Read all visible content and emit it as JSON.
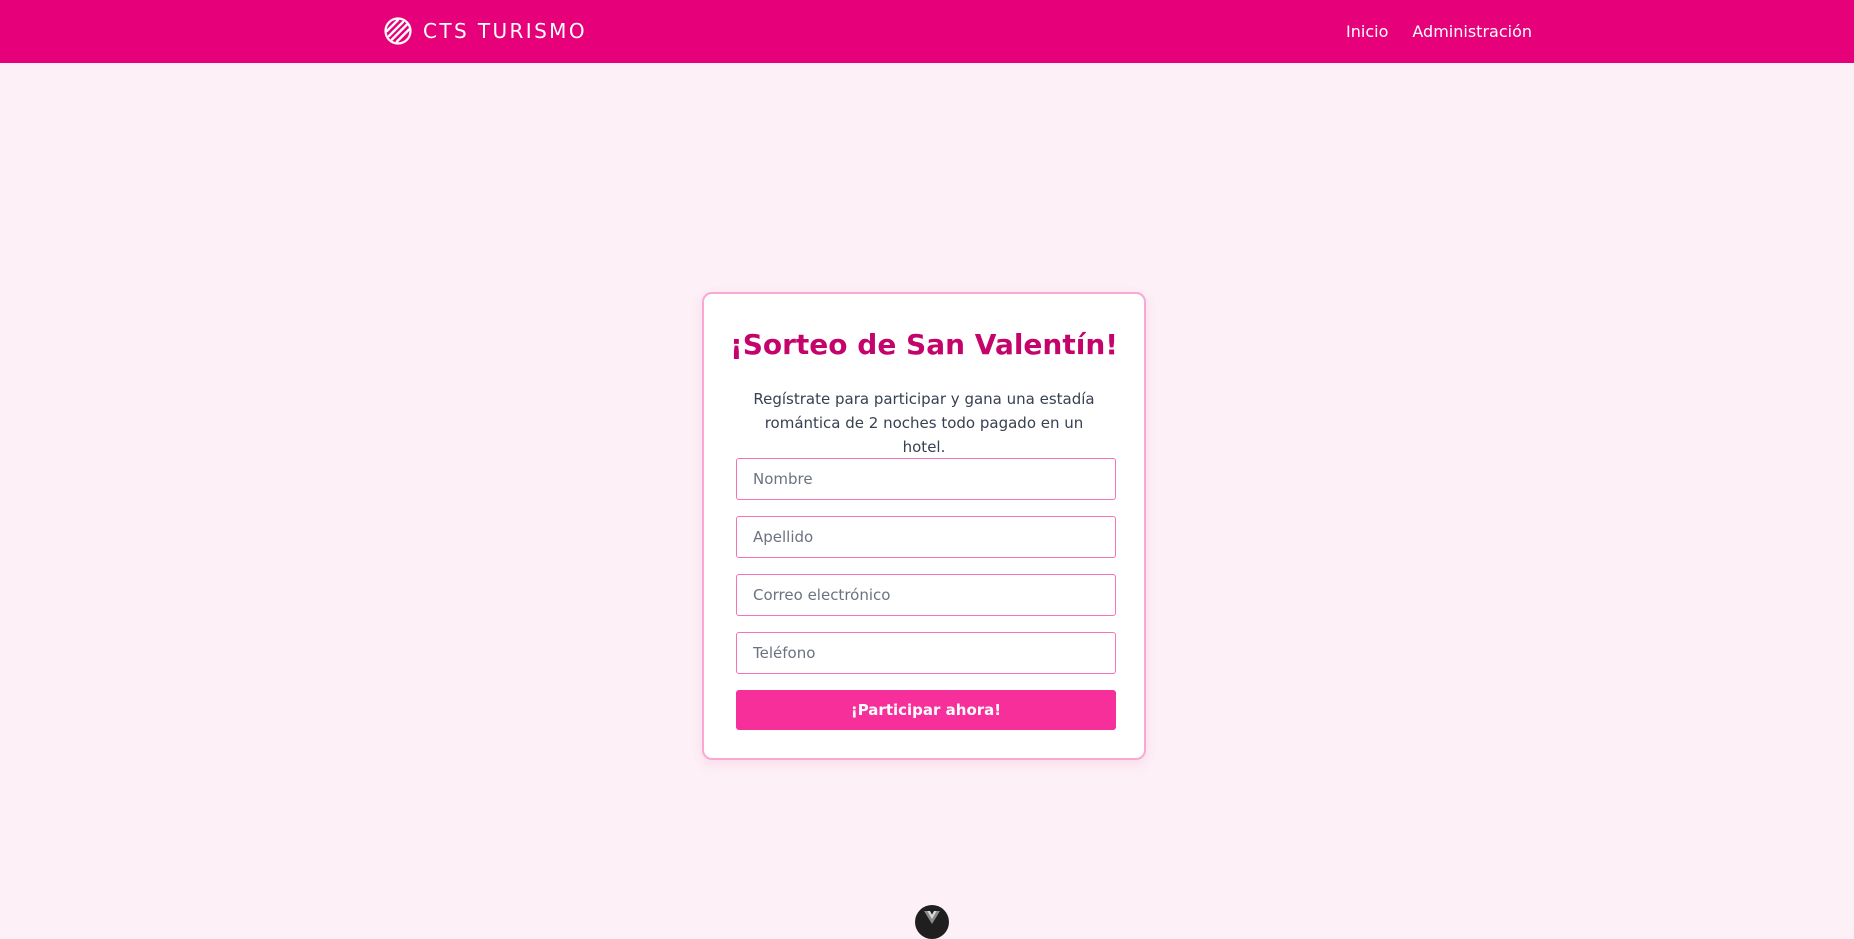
{
  "header": {
    "brand_name": "CTS TURISMO",
    "brand_icon": "cts-globe-logo-icon",
    "nav": [
      {
        "label": "Inicio"
      },
      {
        "label": "Administración"
      }
    ]
  },
  "form": {
    "title": "¡Sorteo de San Valentín!",
    "description": "Regístrate para participar y gana una estadía romántica de 2 noches todo pagado en un hotel.",
    "fields": {
      "nombre": {
        "placeholder": "Nombre",
        "value": ""
      },
      "apellido": {
        "placeholder": "Apellido",
        "value": ""
      },
      "correo": {
        "placeholder": "Correo electrónico",
        "value": ""
      },
      "telefono": {
        "placeholder": "Teléfono",
        "value": ""
      }
    },
    "submit_label": "¡Participar ahora!"
  },
  "floating_badge": {
    "icon": "vue-devtools-icon"
  },
  "colors": {
    "header_background": "#e6007a",
    "page_background": "#fdf0f6",
    "title": "#c5046b",
    "input_border": "#f472b6",
    "card_border": "#f9a8d4",
    "button_background": "#f72f9b"
  }
}
